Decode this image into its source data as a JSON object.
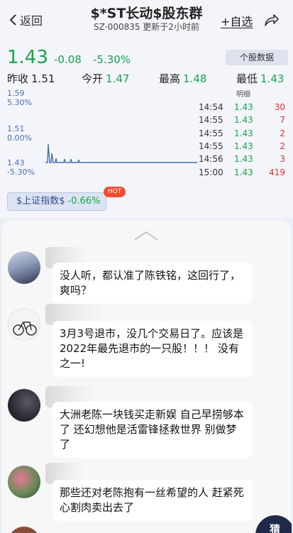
{
  "header": {
    "back_label": "返回",
    "title": "$*ST长动$股东群",
    "subtitle": "SZ·000835  更新于2小时前",
    "add_fav_label": "+自选"
  },
  "quote": {
    "price": "1.43",
    "change": "-0.08",
    "change_pct": "-5.30%",
    "detail_button": "个股数据",
    "prev_close_label": "昨收",
    "prev_close": "1.51",
    "open_label": "今开",
    "open": "1.47",
    "high_label": "最高",
    "high": "1.48",
    "low_label": "最低",
    "low": "1.43",
    "axis_top_price": "1.59",
    "axis_top_pct": "5.30%",
    "axis_mid_price": "1.51",
    "axis_mid_pct": "0.00%",
    "axis_bot_price": "1.43",
    "axis_bot_pct": "-5.30%",
    "trades_label": "明细",
    "trades": [
      {
        "time": "14:54",
        "price": "1.43",
        "qty": "30"
      },
      {
        "time": "14:55",
        "price": "1.43",
        "qty": "7"
      },
      {
        "time": "14:55",
        "price": "1.43",
        "qty": "2"
      },
      {
        "time": "14:55",
        "price": "1.43",
        "qty": "2"
      },
      {
        "time": "14:56",
        "price": "1.43",
        "qty": "3"
      },
      {
        "time": "15:00",
        "price": "1.43",
        "qty": "419"
      }
    ],
    "index_name": "$上证指数$",
    "index_change": "-0.66%",
    "hot_badge": "HOT"
  },
  "chat": {
    "messages": [
      {
        "text": "没人听，都认准了陈铁铭，这回行了，爽吗？"
      },
      {
        "text": "3月3号退市，没几个交易日了。应该是2022年最先退市的一只股！！！ 没有之一!"
      },
      {
        "text": "大洲老陈一块钱买走新娱 自己早捞够本了 还幻想他是活雷锋拯救世界 别做梦了"
      },
      {
        "text": "那些还对老陈抱有一丝希望的人 赶紧死心割肉卖出去了"
      }
    ],
    "guess_label": "猜"
  },
  "colors": {
    "down_green": "#17a34a",
    "up_red": "#e23030",
    "accent_blue": "#4a6fb3"
  }
}
